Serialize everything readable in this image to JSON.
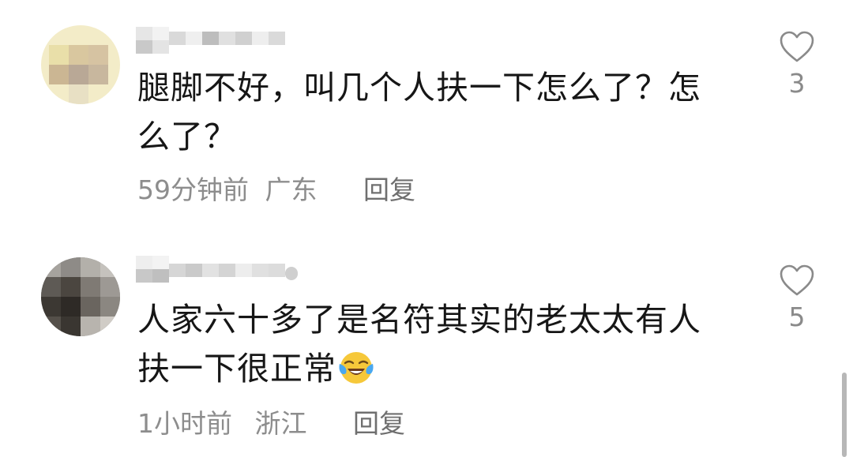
{
  "comments": [
    {
      "text_line1": "腿脚不好，叫几个人扶一下怎么了？怎",
      "text_line2": "么了？",
      "time": "59分钟前",
      "location": "广东",
      "reply_label": "回复",
      "like_count": "3",
      "avatar_icon": "cartoon-avatar-icon"
    },
    {
      "text_line1": "人家六十多了是名符其实的老太太有人",
      "text_line2": "扶一下很正常",
      "emoji": "laughing-crying-emoji-icon",
      "time": "1小时前",
      "location": "浙江",
      "reply_label": "回复",
      "like_count": "5",
      "avatar_icon": "photo-avatar-icon"
    }
  ],
  "colors": {
    "text": "#161616",
    "meta": "#8d8d8d",
    "heart_outline": "#8a8a8a"
  }
}
